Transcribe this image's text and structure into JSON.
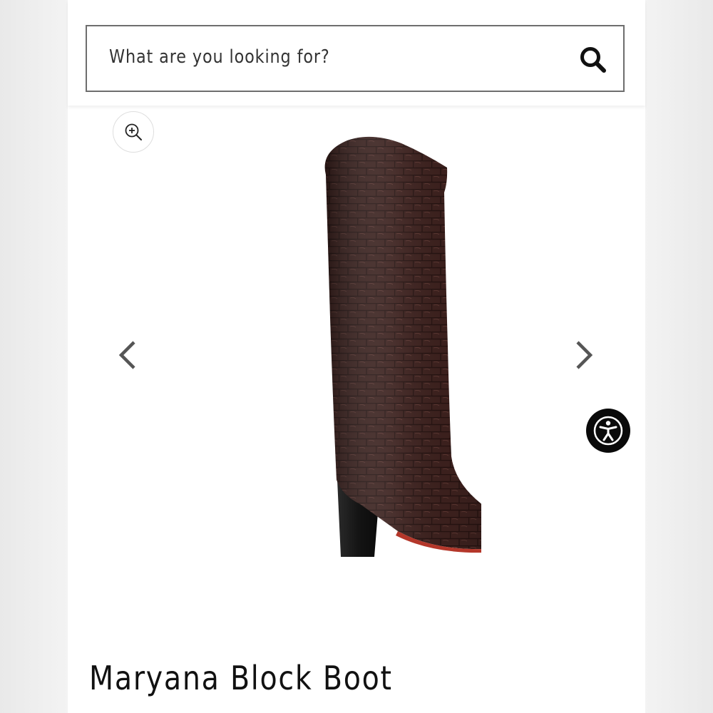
{
  "search": {
    "placeholder": "What are you looking for?",
    "icon": "search-icon"
  },
  "gallery": {
    "zoom_icon": "zoom-in-icon",
    "prev_icon": "chevron-left-icon",
    "next_icon": "chevron-right-icon",
    "image_alt_colors": {
      "leather": "#3a1f1c",
      "heel": "#151515",
      "sole": "#b4372a"
    }
  },
  "accessibility": {
    "icon": "accessibility-icon",
    "color": "#0a0a0a"
  },
  "product": {
    "title": "Maryana Block Boot"
  }
}
